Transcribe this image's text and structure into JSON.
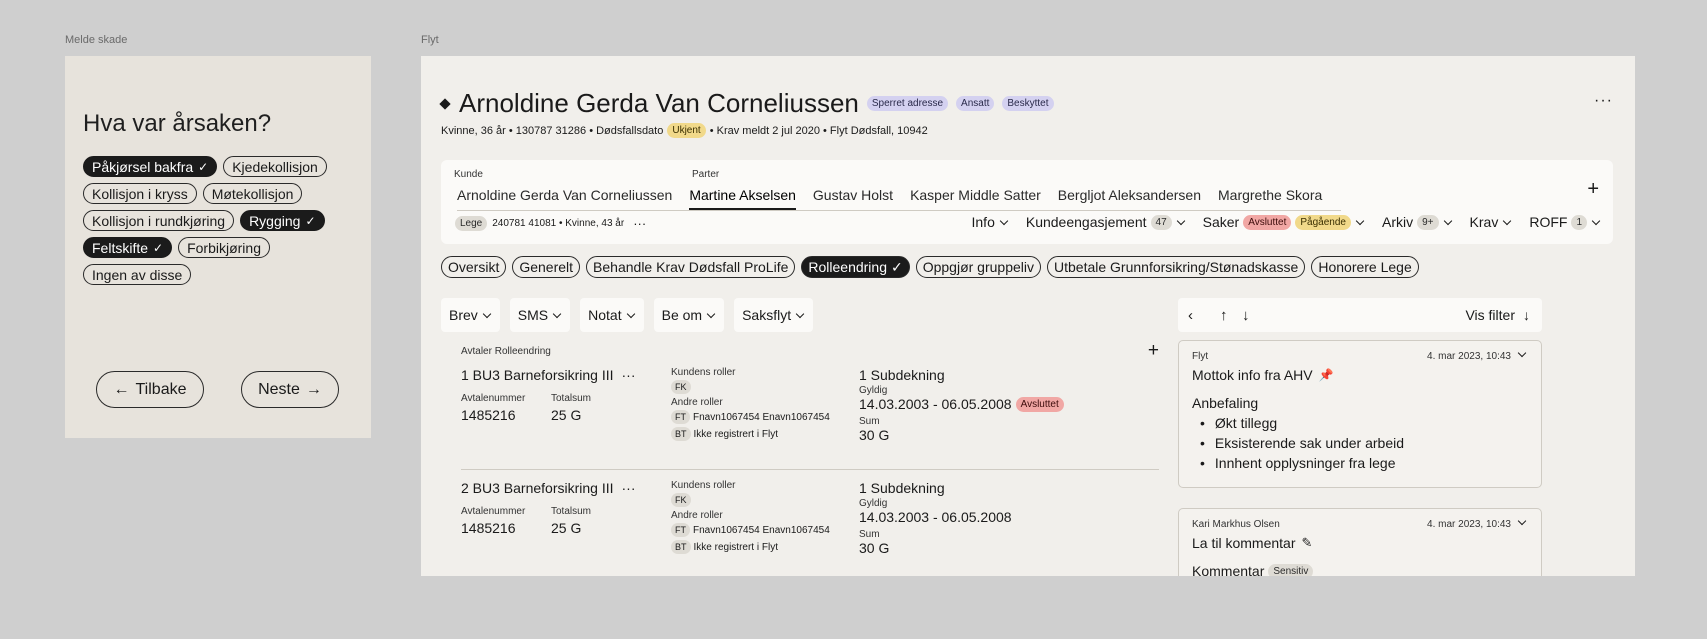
{
  "frames": {
    "left_label": "Melde skade",
    "right_label": "Flyt"
  },
  "question": {
    "title": "Hva var årsaken?",
    "chips": [
      {
        "label": "Påkjørsel bakfra",
        "selected": true
      },
      {
        "label": "Kjedekollisjon",
        "selected": false
      },
      {
        "label": "Kollisjon i kryss",
        "selected": false
      },
      {
        "label": "Møtekollisjon",
        "selected": false
      },
      {
        "label": "Kollisjon i rundkjøring",
        "selected": false
      },
      {
        "label": "Rygging",
        "selected": true
      },
      {
        "label": "Feltskifte",
        "selected": true
      },
      {
        "label": "Forbikjøring",
        "selected": false
      },
      {
        "label": "Ingen av disse",
        "selected": false
      }
    ],
    "back_label": "Tilbake",
    "next_label": "Neste"
  },
  "person": {
    "name": "Arnoldine Gerda Van Corneliussen",
    "tags": [
      "Sperret adresse",
      "Ansatt",
      "Beskyttet"
    ],
    "subline_a": "Kvinne, 36 år • 130787 31286 • Dødsfallsdato",
    "subline_tag": "Ukjent",
    "subline_b": "• Krav meldt 2 jul 2020 • Flyt Dødsfall, 10942",
    "more": "···"
  },
  "customer": {
    "kunde_label": "Kunde",
    "parter_label": "Parter",
    "tabs": [
      "Arnoldine Gerda Van Corneliussen",
      "Martine Akselsen",
      "Gustav Holst",
      "Kasper Middle Satter",
      "Bergljot Aleksandersen",
      "Margrethe Skora"
    ],
    "active_tab": 1,
    "add": "+",
    "info_tag": "Lege",
    "info_text": "240781 41081 • Kvinne, 43 år",
    "info_more": "···",
    "menus": {
      "info": "Info",
      "engagement": "Kundeengasjement",
      "engagement_count": "47",
      "saker": "Saker",
      "saker_tag1": "Avsluttet",
      "saker_tag2": "Pågående",
      "arkiv": "Arkiv",
      "arkiv_count": "9+",
      "krav": "Krav",
      "roff": "ROFF",
      "roff_count": "1"
    }
  },
  "nav_tabs": [
    {
      "label": "Oversikt",
      "active": false
    },
    {
      "label": "Generelt",
      "active": false
    },
    {
      "label": "Behandle Krav Dødsfall ProLife",
      "active": false
    },
    {
      "label": "Rolleendring",
      "active": true
    },
    {
      "label": "Oppgjør gruppeliv",
      "active": false
    },
    {
      "label": "Utbetale Grunnforsikring/Stønadskasse",
      "active": false
    },
    {
      "label": "Honorere Lege",
      "active": false
    }
  ],
  "actions": [
    "Brev",
    "SMS",
    "Notat",
    "Be om",
    "Saksflyt"
  ],
  "agreements": {
    "header": "Avtaler Rolleendring",
    "add": "+",
    "rows": [
      {
        "title": "1 BU3 Barneforsikring III",
        "more": "···",
        "avtalenummer_label": "Avtalenummer",
        "avtalenummer": "1485216",
        "totalsum_label": "Totalsum",
        "totalsum": "25 G",
        "kundens_roller_label": "Kundens roller",
        "kundens_rolle": "FK",
        "andre_roller_label": "Andre roller",
        "rolle1_tag": "FT",
        "rolle1_text": "Fnavn1067454 Enavn1067454",
        "rolle2_tag": "BT",
        "rolle2_text": "Ikke registrert i Flyt",
        "subdekning": "1 Subdekning",
        "gyldig_label": "Gyldig",
        "gyldig": "14.03.2003 - 06.05.2008",
        "status_tag": "Avsluttet",
        "sum_label": "Sum",
        "sum": "30 G"
      },
      {
        "title": "2 BU3 Barneforsikring III",
        "more": "···",
        "avtalenummer_label": "Avtalenummer",
        "avtalenummer": "1485216",
        "totalsum_label": "Totalsum",
        "totalsum": "25 G",
        "kundens_roller_label": "Kundens roller",
        "kundens_rolle": "FK",
        "andre_roller_label": "Andre roller",
        "rolle1_tag": "FT",
        "rolle1_text": "Fnavn1067454 Enavn1067454",
        "rolle2_tag": "BT",
        "rolle2_text": "Ikke registrert i Flyt",
        "subdekning": "1 Subdekning",
        "gyldig_label": "Gyldig",
        "gyldig": "14.03.2003 - 06.05.2008",
        "status_tag": "",
        "sum_label": "Sum",
        "sum": "30 G"
      }
    ]
  },
  "side": {
    "filter_label": "Vis filter",
    "note1": {
      "source": "Flyt",
      "date": "4. mar 2023, 10:43",
      "title": "Mottok info fra AHV",
      "heading": "Anbefaling",
      "bullets": [
        "Økt tillegg",
        "Eksisterende sak under arbeid",
        "Innhent opplysninger fra lege"
      ]
    },
    "note2": {
      "source": "Kari Markhus Olsen",
      "date": "4. mar 2023, 10:43",
      "title": "La til kommentar",
      "heading": "Kommentar",
      "tag": "Sensitiv"
    }
  }
}
